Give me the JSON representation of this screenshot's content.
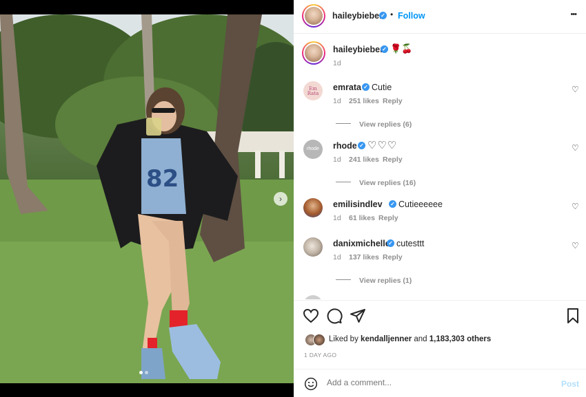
{
  "post": {
    "header": {
      "username": "haileybieber",
      "follow_label": "Follow",
      "more_label": "•••"
    },
    "caption": {
      "username": "haileybieber",
      "text": "🌹🍒",
      "time": "1d"
    },
    "comments": [
      {
        "username": "emrata",
        "text": "Cutie",
        "time": "1d",
        "likes": "251 likes",
        "reply": "Reply",
        "view_replies": "View replies (6)",
        "avatar_text": "Em Rata"
      },
      {
        "username": "rhode",
        "text": "♡♡♡",
        "time": "1d",
        "likes": "241 likes",
        "reply": "Reply",
        "view_replies": "View replies (16)",
        "avatar_text": "rhode"
      },
      {
        "username": "emilisindlev",
        "text": "Cutieeeeee",
        "time": "1d",
        "likes": "61 likes",
        "reply": "Reply"
      },
      {
        "username": "danixmichelle",
        "text": "cutesttt",
        "time": "1d",
        "likes": "137 likes",
        "reply": "Reply",
        "view_replies": "View replies (1)"
      }
    ],
    "likes": {
      "prefix": "Liked by",
      "user": "kendalljenner",
      "and": "and",
      "count": "1,183,303 others"
    },
    "timestamp": "1 DAY AGO",
    "comment_box": {
      "placeholder": "Add a comment...",
      "post_label": "Post"
    },
    "photo": {
      "jersey_text": "82"
    }
  },
  "colors": {
    "accent": "#0095f6",
    "verified": "#3897f0",
    "muted": "#8e8e8e"
  }
}
